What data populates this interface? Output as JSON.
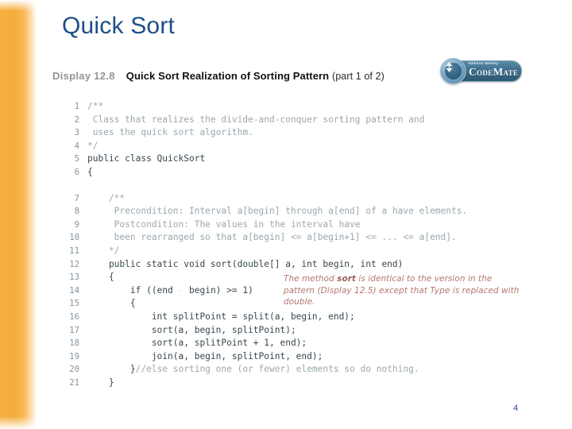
{
  "slide": {
    "title": "Quick Sort",
    "page_number": "4",
    "title_color": "#1d4e89",
    "accent_band_color": "#f6ad3d"
  },
  "logo": {
    "brandline": "Addison Wesley",
    "wordmark": "CodeMate",
    "badge_glyph": "triangle-emblem"
  },
  "display": {
    "label": "Display 12.8",
    "title": "Quick Sort Realization of Sorting Pattern",
    "part": "(part 1 of 2)"
  },
  "annotation": {
    "text_before": "The method ",
    "bold_token": "sort",
    "text_after": " is identical to the version in the pattern (Display 12.5) except that Type is replaced with double."
  },
  "code": {
    "lines": [
      {
        "n": "1",
        "text": "/**",
        "kind": "comment",
        "indent": 0
      },
      {
        "n": "2",
        "text": " Class that realizes the divide-and-conquer sorting pattern and",
        "kind": "comment",
        "indent": 0
      },
      {
        "n": "3",
        "text": " uses the quick sort algorithm.",
        "kind": "comment",
        "indent": 0
      },
      {
        "n": "4",
        "text": "*/",
        "kind": "comment",
        "indent": 0
      },
      {
        "n": "5",
        "text": "public class QuickSort",
        "kind": "code",
        "indent": 0
      },
      {
        "n": "6",
        "text": "{",
        "kind": "code",
        "indent": 0
      },
      {
        "n": "",
        "text": "",
        "kind": "spacer",
        "indent": 0
      },
      {
        "n": "7",
        "text": "    /**",
        "kind": "comment",
        "indent": 0
      },
      {
        "n": "8",
        "text": "     Precondition: Interval a[begin] through a[end] of a have elements.",
        "kind": "comment",
        "indent": 0
      },
      {
        "n": "9",
        "text": "     Postcondition: The values in the interval have",
        "kind": "comment",
        "indent": 0
      },
      {
        "n": "10",
        "text": "     been rearranged so that a[begin] <= a[begin+1] <= ... <= a[end].",
        "kind": "comment",
        "indent": 0
      },
      {
        "n": "11",
        "text": "    */",
        "kind": "comment",
        "indent": 0
      },
      {
        "n": "12",
        "text": "    public static void sort(double[] a, int begin, int end)",
        "kind": "code",
        "indent": 0
      },
      {
        "n": "13",
        "text": "    {",
        "kind": "code",
        "indent": 0
      },
      {
        "n": "14",
        "text": "        if ((end - begin) >= 1)",
        "kind": "code",
        "indent": 0
      },
      {
        "n": "15",
        "text": "        {",
        "kind": "code",
        "indent": 0
      },
      {
        "n": "16",
        "text": "            int splitPoint = split(a, begin, end);",
        "kind": "code",
        "indent": 0
      },
      {
        "n": "17",
        "text": "            sort(a, begin, splitPoint);",
        "kind": "code",
        "indent": 0
      },
      {
        "n": "18",
        "text": "            sort(a, splitPoint + 1, end);",
        "kind": "code",
        "indent": 0
      },
      {
        "n": "19",
        "text": "            join(a, begin, splitPoint, end);",
        "kind": "code",
        "indent": 0
      },
      {
        "n": "20",
        "text": "        }//else sorting one (or fewer) elements so do nothing.",
        "kind": "mixed",
        "indent": 0,
        "split_at": 9
      },
      {
        "n": "21",
        "text": "    }",
        "kind": "code",
        "indent": 0
      }
    ]
  }
}
